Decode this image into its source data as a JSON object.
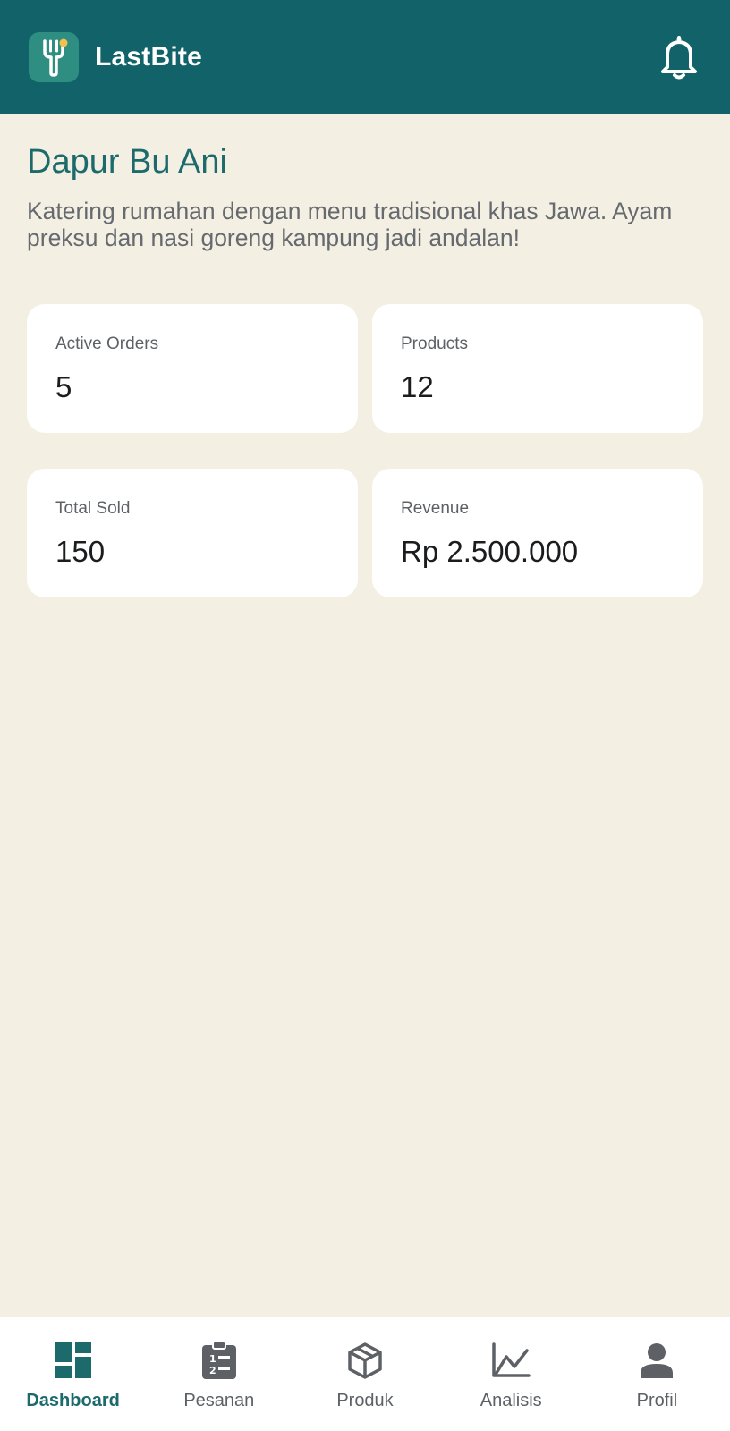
{
  "header": {
    "app_name": "LastBite",
    "logo_icon": "fork-icon",
    "notification_icon": "bell-icon"
  },
  "store": {
    "name": "Dapur Bu Ani",
    "description": "Katering rumahan dengan menu tradisional khas Jawa. Ayam preksu dan nasi goreng kampung jadi andalan!"
  },
  "stats": [
    {
      "label": "Active Orders",
      "value": "5"
    },
    {
      "label": "Products",
      "value": "12"
    },
    {
      "label": "Total Sold",
      "value": "150"
    },
    {
      "label": "Revenue",
      "value": "Rp 2.500.000"
    }
  ],
  "nav": [
    {
      "label": "Dashboard",
      "icon": "dashboard-icon",
      "active": true
    },
    {
      "label": "Pesanan",
      "icon": "clipboard-list-icon",
      "active": false
    },
    {
      "label": "Produk",
      "icon": "box-icon",
      "active": false
    },
    {
      "label": "Analisis",
      "icon": "line-chart-icon",
      "active": false
    },
    {
      "label": "Profil",
      "icon": "person-icon",
      "active": false
    }
  ],
  "colors": {
    "primary": "#126369",
    "accent_text": "#1D6A6C",
    "background": "#F3EFE3",
    "logo_dot": "#F2C14E"
  }
}
